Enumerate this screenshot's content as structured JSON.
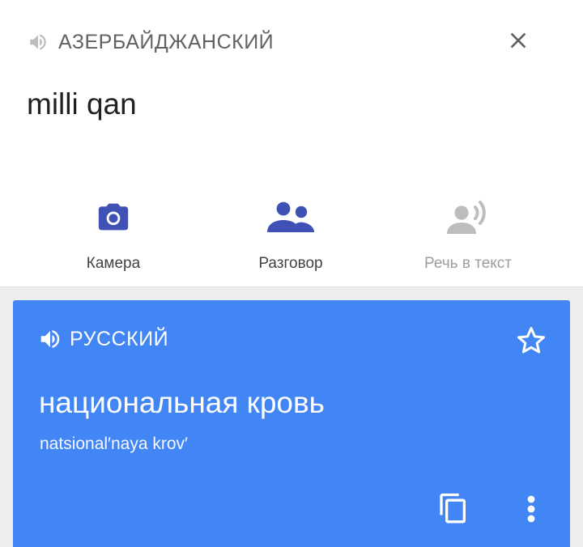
{
  "source": {
    "language_label": "АЗЕРБАЙДЖАНСКИЙ",
    "text": "milli qan",
    "icons": {
      "speaker": "speaker-icon",
      "close": "close-icon"
    }
  },
  "tools": [
    {
      "label": "Камера",
      "icon": "camera-icon",
      "enabled": true
    },
    {
      "label": "Разговор",
      "icon": "conversation-icon",
      "enabled": true
    },
    {
      "label": "Речь в текст",
      "icon": "speech-to-text-icon",
      "enabled": false
    }
  ],
  "result": {
    "language_label": "РУССКИЙ",
    "translation": "национальная кровь",
    "transliteration": "natsional′naya krov′",
    "icons": {
      "speaker": "speaker-icon",
      "star": "star-outline-icon",
      "copy": "copy-icon",
      "more": "more-vert-icon"
    }
  },
  "colors": {
    "accent_blue": "#4285f4",
    "tool_icon_blue": "#3f51b5",
    "disabled_gray": "#bdbdbd",
    "text_gray": "#616161"
  }
}
